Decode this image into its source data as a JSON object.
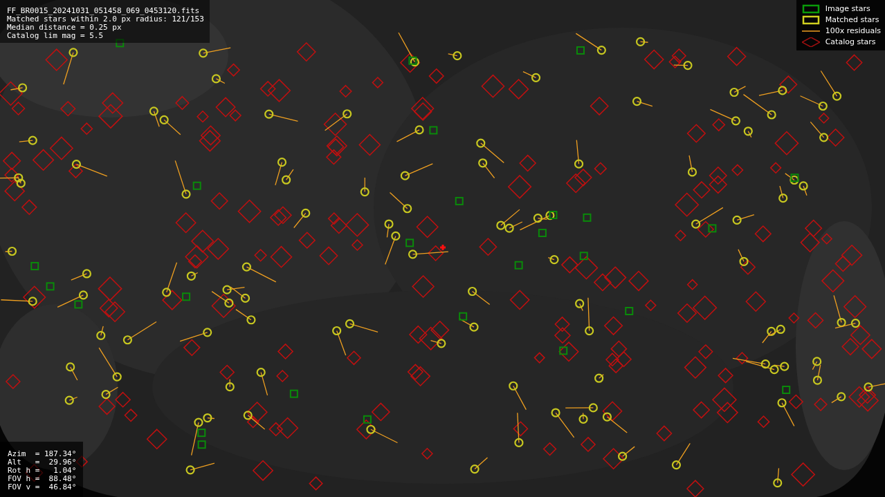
{
  "file_info": {
    "lines": [
      "FF_BR0015_20241031_051458_069_0453120.fits",
      "Matched stars within 2.0 px radius: 121/153",
      "Median distance = 0.25 px",
      "Catalog lim mag = 5.5"
    ]
  },
  "legend": [
    {
      "label": "Image stars"
    },
    {
      "label": "Matched stars",
      "kind": "matched"
    },
    {
      "label": "100x residuals",
      "kind": "residual"
    },
    {
      "label": "Catalog stars",
      "kind": "catalog"
    }
  ],
  "pointing": {
    "lines": [
      "Azim  = 187.34°",
      "Alt   =  29.96°",
      "Rot h =   1.04°",
      "FOV h =  88.48°",
      "FOV v =  46.84°"
    ]
  }
}
